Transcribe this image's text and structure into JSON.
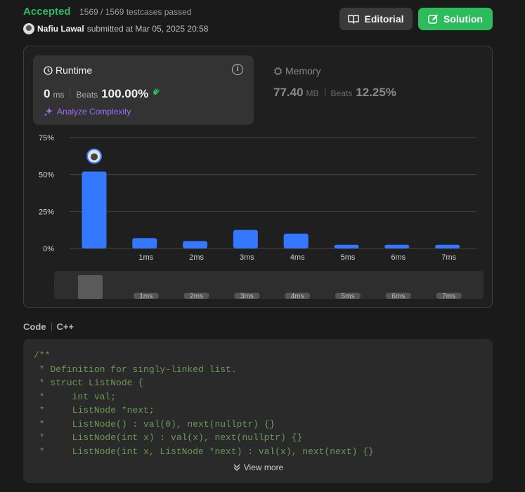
{
  "header": {
    "status": "Accepted",
    "tests": "1569 / 1569 testcases passed",
    "author": "Nafiu Lawal",
    "submitted": "submitted at Mar 05, 2025 20:58",
    "editorial_label": "Editorial",
    "solution_label": "Solution"
  },
  "runtime": {
    "title": "Runtime",
    "value": "0",
    "unit": "ms",
    "beats_label": "Beats",
    "beats_value": "100.00%",
    "analyze_label": "Analyze Complexity"
  },
  "memory": {
    "title": "Memory",
    "value": "77.40",
    "unit": "MB",
    "beats_label": "Beats",
    "beats_value": "12.25%"
  },
  "chart_data": {
    "type": "bar",
    "categories": [
      "",
      "1ms",
      "2ms",
      "3ms",
      "4ms",
      "5ms",
      "6ms",
      "7ms"
    ],
    "values": [
      52,
      7,
      5,
      12.5,
      10,
      2.5,
      2.5,
      2.5
    ],
    "ylabels": [
      "75%",
      "50%",
      "25%",
      "0%"
    ],
    "ylim": [
      0,
      75
    ],
    "highlight_index": 0,
    "bar_color": "#3378ff"
  },
  "code": {
    "label": "Code",
    "language": "C++",
    "lines": [
      "/**",
      " * Definition for singly-linked list.",
      " * struct ListNode {",
      " *     int val;",
      " *     ListNode *next;",
      " *     ListNode() : val(0), next(nullptr) {}",
      " *     ListNode(int x) : val(x), next(nullptr) {}",
      " *     ListNode(int x, ListNode *next) : val(x), next(next) {}"
    ],
    "view_more": "View more"
  }
}
